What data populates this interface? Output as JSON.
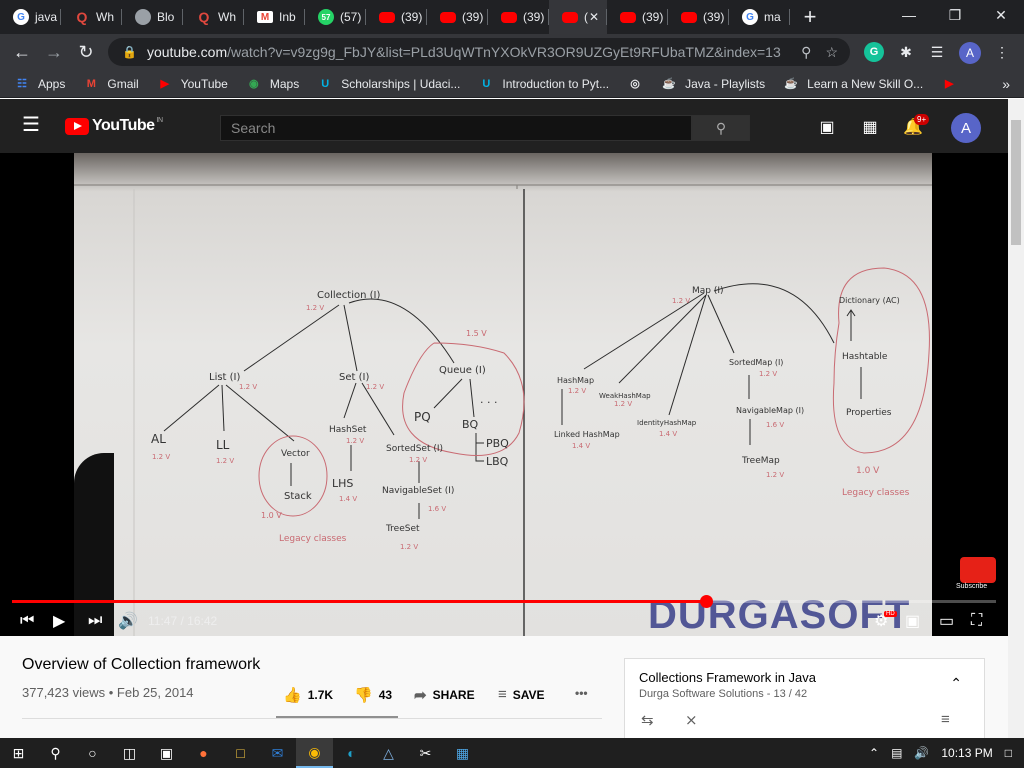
{
  "browser": {
    "tabs": [
      {
        "label": "java",
        "icon": "google-icon"
      },
      {
        "label": "Wh",
        "icon": "quora-icon"
      },
      {
        "label": "Blo",
        "icon": "globe-icon"
      },
      {
        "label": "Wh",
        "icon": "quora-icon"
      },
      {
        "label": "Inb",
        "icon": "gmail-icon"
      },
      {
        "label": "(57)",
        "icon": "whatsapp-icon",
        "badge": "57"
      },
      {
        "label": "(39)",
        "icon": "youtube-icon"
      },
      {
        "label": "(39)",
        "icon": "youtube-icon"
      },
      {
        "label": "(39)",
        "icon": "youtube-icon"
      },
      {
        "label": "(",
        "icon": "youtube-icon",
        "active": true
      },
      {
        "label": "(39)",
        "icon": "youtube-icon"
      },
      {
        "label": "(39)",
        "icon": "youtube-icon"
      },
      {
        "label": "ma",
        "icon": "google-icon"
      }
    ],
    "new_tab": "+",
    "address": {
      "host": "youtube.com",
      "path": "/watch?v=v9zg9g_FbJY&list=PLd3UqWTnYXOkVR3OR9UZGyEt9RFUbaTMZ&index=13"
    },
    "profile_initial": "A",
    "bookmarks": [
      {
        "label": "Apps",
        "icon": "apps-grid-icon"
      },
      {
        "label": "Gmail",
        "icon": "gmail-icon"
      },
      {
        "label": "YouTube",
        "icon": "youtube-icon"
      },
      {
        "label": "Maps",
        "icon": "maps-pin-icon"
      },
      {
        "label": "Scholarships | Udaci...",
        "icon": "udacity-icon"
      },
      {
        "label": "Introduction to Pyt...",
        "icon": "udacity-icon"
      },
      {
        "label": "",
        "icon": "globe-icon"
      },
      {
        "label": "Java - Playlists",
        "icon": "java-icon"
      },
      {
        "label": "Learn a New Skill O...",
        "icon": "java-icon"
      },
      {
        "label": "",
        "icon": "youtube-icon"
      }
    ],
    "bookmarks_more": "»"
  },
  "youtube": {
    "logo_text": "YouTube",
    "logo_region": "IN",
    "search_placeholder": "Search",
    "notification_count": "9+",
    "avatar_initial": "A"
  },
  "player": {
    "time_current": "11:47",
    "time_total": "16:42",
    "progress_fraction": 0.705,
    "watermark": "DURGASOFT",
    "subscribe_label": "Subscribe",
    "hd_badge": "HD",
    "board": {
      "nodes": {
        "collection": "Collection (I)",
        "collection_ver": "1.2 V",
        "list": "List (I)",
        "list_ver": "1.2 V",
        "set": "Set (I)",
        "set_ver": "1.2 V",
        "queue": "Queue (I)",
        "queue_ver": "1.5 V",
        "al": "AL",
        "al_ver": "1.2 V",
        "ll": "LL",
        "ll_ver": "1.2 V",
        "vector": "Vector",
        "stack": "Stack",
        "legacy_ver_left": "1.0 V",
        "legacy_left": "Legacy classes",
        "hashset": "HashSet",
        "hashset_ver": "1.2 V",
        "lhs": "LHS",
        "lhs_ver": "1.4 V",
        "sortedset": "SortedSet (I)",
        "sortedset_ver": "1.2 V",
        "navset": "NavigableSet (I)",
        "navset_ver": "1.6 V",
        "treeset": "TreeSet",
        "treeset_ver": "1.2 V",
        "pq": "PQ",
        "bq": "BQ",
        "pbq": "PBQ",
        "lbq": "LBQ",
        "dots": ". . .",
        "map": "Map (I)",
        "map_ver": "1.2 V",
        "hashmap": "HashMap",
        "hashmap_ver": "1.2 V",
        "linkedhashmap": "Linked HashMap",
        "linkedhashmap_ver": "1.4 V",
        "weakhashmap": "WeakHashMap",
        "weakhashmap_ver": "1.2 V",
        "identityhashmap": "IdentityHashMap",
        "identityhashmap_ver": "1.4 V",
        "sortedmap": "SortedMap (I)",
        "sortedmap_ver": "1.2 V",
        "navmap": "NavigableMap (I)",
        "navmap_ver": "1.6 V",
        "treemap": "TreeMap",
        "treemap_ver": "1.2 V",
        "dictionary": "Dictionary (AC)",
        "hashtable": "Hashtable",
        "properties": "Properties",
        "legacy_ver_right": "1.0 V",
        "legacy_right": "Legacy classes"
      }
    }
  },
  "video": {
    "title": "Overview of Collection framework",
    "views": "377,423 views",
    "date": "Feb 25, 2014",
    "likes": "1.7K",
    "dislikes": "43",
    "share": "SHARE",
    "save": "SAVE",
    "more": "•••"
  },
  "playlist": {
    "title": "Collections Framework in Java",
    "channel": "Durga Software Solutions",
    "position": "13 / 42"
  },
  "taskbar": {
    "time": "10:13 PM"
  }
}
